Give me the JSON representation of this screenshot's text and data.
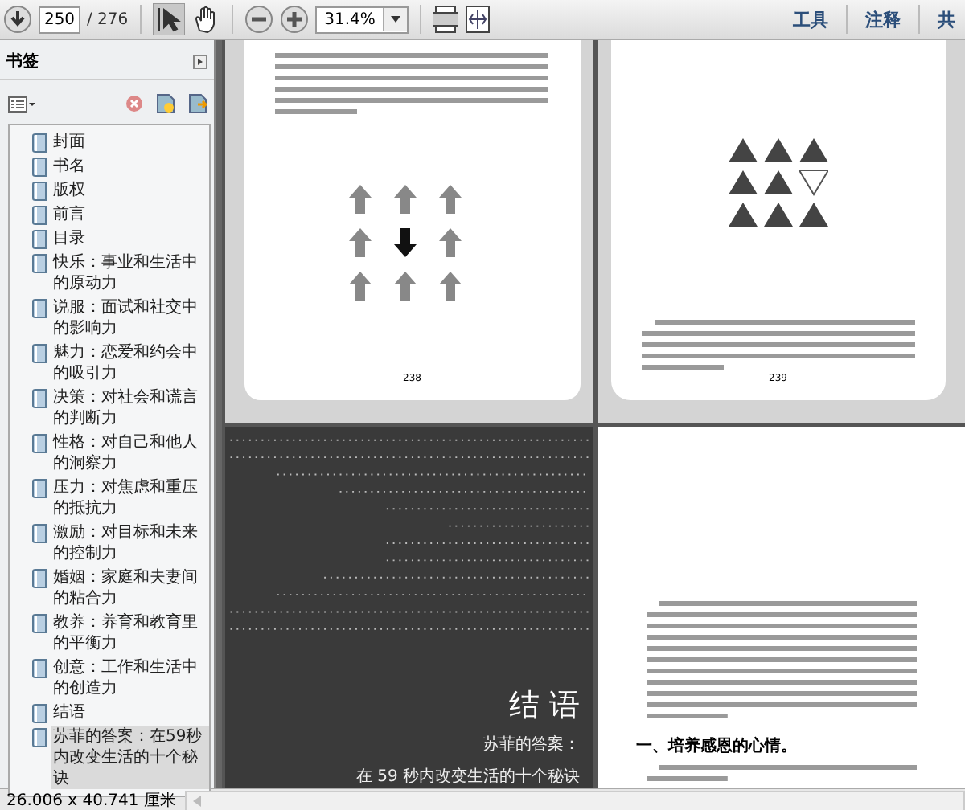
{
  "toolbar": {
    "page_field": "250",
    "page_total": "/ 276",
    "zoom_field": "31.4%",
    "menu_tabs": [
      {
        "label": "工具"
      },
      {
        "label": "注释"
      },
      {
        "label": "共"
      }
    ]
  },
  "sidebar": {
    "title": "书签",
    "bookmarks": [
      {
        "label": "封面",
        "selected": false
      },
      {
        "label": "书名",
        "selected": false
      },
      {
        "label": "版权",
        "selected": false
      },
      {
        "label": "前言",
        "selected": false
      },
      {
        "label": "目录",
        "selected": false
      },
      {
        "label": "快乐：事业和生活中的原动力",
        "selected": false
      },
      {
        "label": "说服：面试和社交中的影响力",
        "selected": false
      },
      {
        "label": "魅力：恋爱和约会中的吸引力",
        "selected": false
      },
      {
        "label": "决策：对社会和谎言的判断力",
        "selected": false
      },
      {
        "label": "性格：对自己和他人的洞察力",
        "selected": false
      },
      {
        "label": "压力：对焦虑和重压的抵抗力",
        "selected": false
      },
      {
        "label": "激励：对目标和未来的控制力",
        "selected": false
      },
      {
        "label": "婚姻：家庭和夫妻间的粘合力",
        "selected": false
      },
      {
        "label": "教养：养育和教育里的平衡力",
        "selected": false
      },
      {
        "label": "创意：工作和生活中的创造力",
        "selected": false
      },
      {
        "label": "结语",
        "selected": false
      },
      {
        "label": "苏菲的答案：在59秒内改变生活的十个秘诀",
        "selected": true
      }
    ]
  },
  "pages": [
    {
      "kind": "arrows",
      "page_number": "238"
    },
    {
      "kind": "triangles",
      "page_number": "239"
    },
    {
      "kind": "chapter",
      "title": "结 语",
      "subtitle": "苏菲的答案：",
      "tagline": "在 59 秒内改变生活的十个秘诀"
    },
    {
      "kind": "text",
      "heading": "一、培养感恩的心情。"
    }
  ],
  "status_bar": {
    "page_size": "26.006 x 40.741 厘米"
  }
}
